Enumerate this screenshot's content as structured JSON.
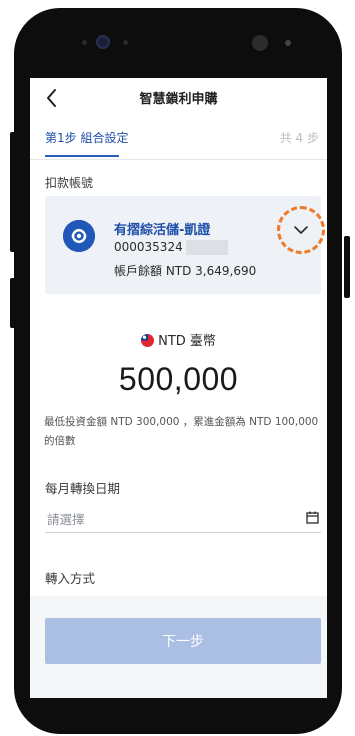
{
  "header": {
    "title": "智慧鎖利申購",
    "back_icon": "chevron-left-icon"
  },
  "steps": {
    "current": "第1步 組合設定",
    "total": "共 4 步"
  },
  "debit_account": {
    "label": "扣款帳號",
    "name": "有摺綜活儲-凱證",
    "number_prefix": "000035324",
    "balance": "帳戶餘額 NTD 3,649,690",
    "expand_icon": "chevron-down-icon",
    "highlight_color": "#f07a2a"
  },
  "currency": {
    "label": "NTD 臺幣",
    "flag_icon": "taiwan-flag-icon"
  },
  "amount": "500,000",
  "note": "最低投資金額 NTD 300,000 ，累進金額為 NTD 100,000 的倍數",
  "monthly_date": {
    "label": "每月轉換日期",
    "placeholder": "請選擇",
    "icon": "calendar-icon"
  },
  "transfer_method": {
    "label": "轉入方式"
  },
  "next_button": {
    "label": "下一步",
    "color": "#aabfe3"
  },
  "colors": {
    "brand_blue": "#1f4fa8",
    "card_background": "#eef1f5"
  }
}
